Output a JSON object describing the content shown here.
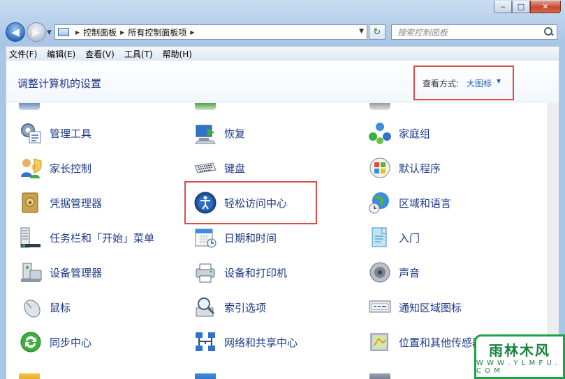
{
  "window": {
    "caption_min": "‒",
    "caption_max": "□",
    "caption_close": "✕"
  },
  "navbar": {
    "breadcrumb": [
      "控制面板",
      "所有控制面板项"
    ],
    "search_placeholder": "搜索控制面板"
  },
  "menubar": [
    "文件(F)",
    "编辑(E)",
    "查看(V)",
    "工具(T)",
    "帮助(H)"
  ],
  "header": {
    "title": "调整计算机的设置",
    "view_label": "查看方式:",
    "view_value": "大图标"
  },
  "items": [
    {
      "label": "管理工具",
      "icon": "admin-tools-icon"
    },
    {
      "label": "恢复",
      "icon": "recovery-icon"
    },
    {
      "label": "家庭组",
      "icon": "homegroup-icon"
    },
    {
      "label": "家长控制",
      "icon": "parental-controls-icon"
    },
    {
      "label": "键盘",
      "icon": "keyboard-icon"
    },
    {
      "label": "默认程序",
      "icon": "default-programs-icon"
    },
    {
      "label": "凭据管理器",
      "icon": "credential-manager-icon"
    },
    {
      "label": "轻松访问中心",
      "icon": "ease-of-access-icon"
    },
    {
      "label": "区域和语言",
      "icon": "region-language-icon"
    },
    {
      "label": "任务栏和「开始」菜单",
      "icon": "taskbar-icon"
    },
    {
      "label": "日期和时间",
      "icon": "date-time-icon"
    },
    {
      "label": "入门",
      "icon": "getting-started-icon"
    },
    {
      "label": "设备管理器",
      "icon": "device-manager-icon"
    },
    {
      "label": "设备和打印机",
      "icon": "devices-printers-icon"
    },
    {
      "label": "声音",
      "icon": "sound-icon"
    },
    {
      "label": "鼠标",
      "icon": "mouse-icon"
    },
    {
      "label": "索引选项",
      "icon": "indexing-options-icon"
    },
    {
      "label": "通知区域图标",
      "icon": "notification-area-icon"
    },
    {
      "label": "同步中心",
      "icon": "sync-center-icon"
    },
    {
      "label": "网络和共享中心",
      "icon": "network-sharing-icon"
    },
    {
      "label": "位置和其他传感器",
      "icon": "location-sensors-icon"
    }
  ],
  "watermark": {
    "main": "雨林木风",
    "sub": "W W W . Y L M F U . C O M"
  }
}
